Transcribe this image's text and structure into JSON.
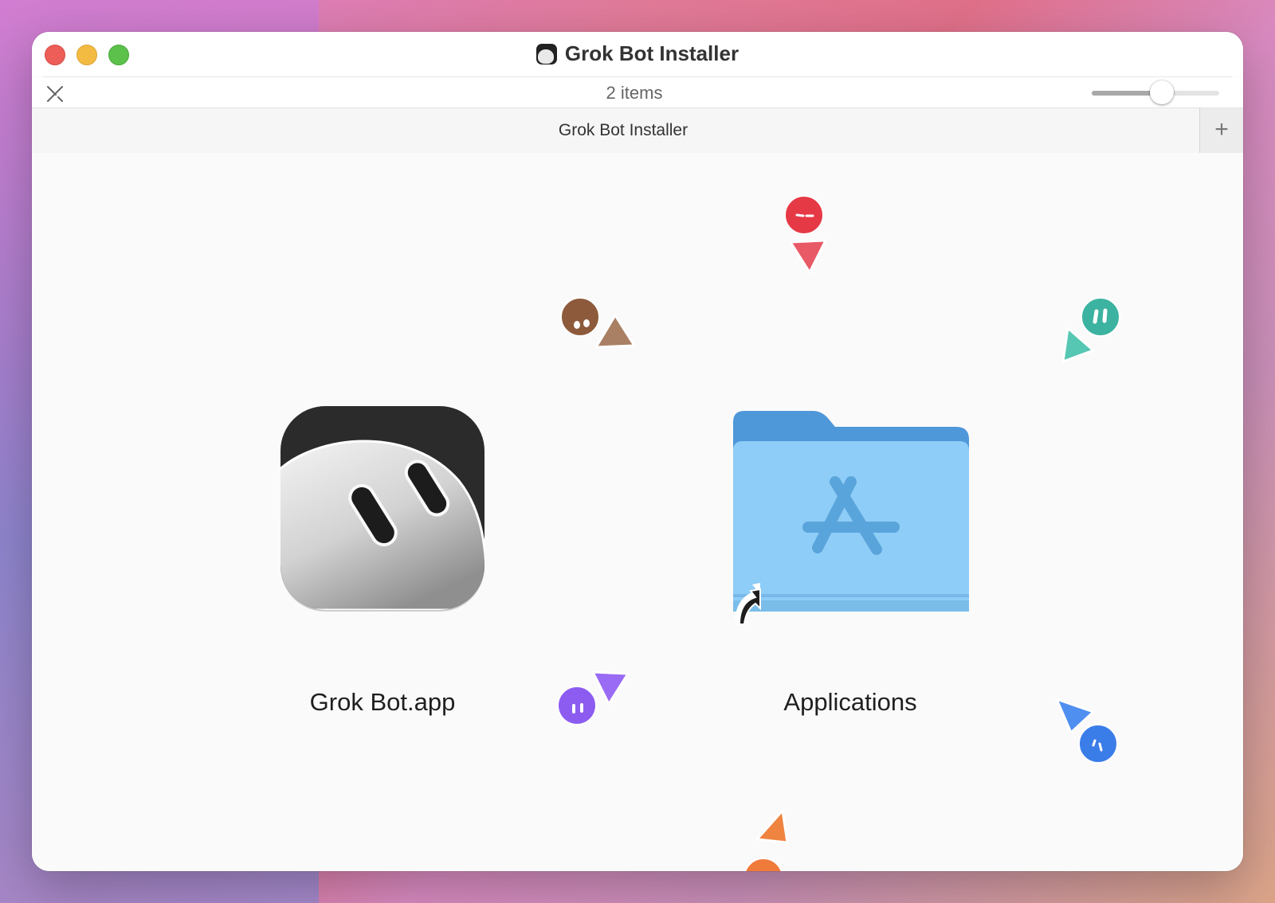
{
  "window": {
    "title": "Grok Bot Installer",
    "buttons": [
      "close",
      "minimize",
      "zoom"
    ]
  },
  "toolbar": {
    "item_count": "2 items",
    "icon_size_slider_value": 0.55
  },
  "pathbar": {
    "label": "Grok Bot Installer",
    "add_tab_label": "+"
  },
  "items": [
    {
      "label": "Grok Bot.app",
      "icon": "grok-bot-app-icon"
    },
    {
      "label": "Applications",
      "icon": "applications-folder-alias-icon"
    }
  ],
  "decorations": {
    "cursor_colors": [
      "#e63946",
      "#8d5a3b",
      "#3cb3a0",
      "#8c5cf0",
      "#3b7de8",
      "#ef8440"
    ]
  }
}
